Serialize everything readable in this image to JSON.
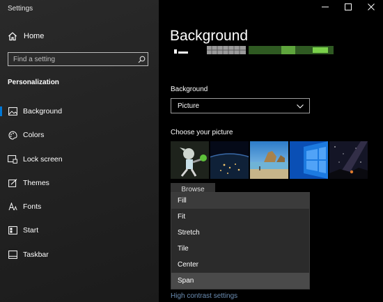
{
  "app": {
    "title": "Settings"
  },
  "window_controls": {
    "minimize": "minimize-icon",
    "maximize": "maximize-icon",
    "close": "close-icon"
  },
  "sidebar": {
    "home_label": "Home",
    "search_placeholder": "Find a setting",
    "section_title": "Personalization",
    "items": [
      {
        "label": "Background",
        "icon": "background-icon",
        "active": true
      },
      {
        "label": "Colors",
        "icon": "palette-icon"
      },
      {
        "label": "Lock screen",
        "icon": "lock-screen-icon"
      },
      {
        "label": "Themes",
        "icon": "themes-icon"
      },
      {
        "label": "Fonts",
        "icon": "fonts-icon"
      },
      {
        "label": "Start",
        "icon": "start-icon"
      },
      {
        "label": "Taskbar",
        "icon": "taskbar-icon"
      }
    ]
  },
  "main": {
    "title": "Background",
    "background_label": "Background",
    "background_value": "Picture",
    "choose_picture_label": "Choose your picture",
    "browse_label": "Browse",
    "fit_options": [
      "Fill",
      "Fit",
      "Stretch",
      "Tile",
      "Center",
      "Span"
    ],
    "fit_highlighted": "Fill",
    "fit_selected": "Span",
    "high_contrast_link": "High contrast settings"
  },
  "colors": {
    "accent": "#0078d7",
    "sidebar_bg": "#232323",
    "main_bg": "#000000"
  }
}
